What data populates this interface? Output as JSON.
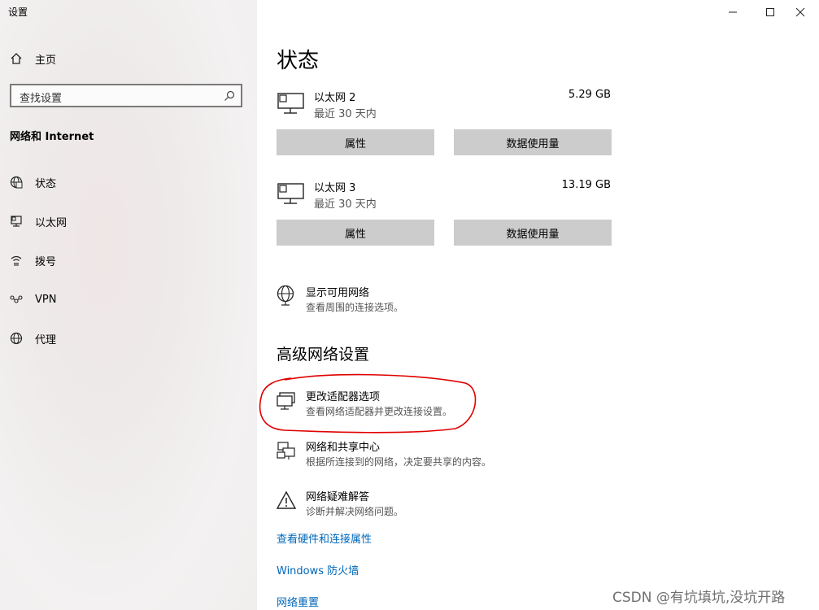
{
  "app": {
    "title": "设置"
  },
  "sidebar": {
    "home": "主页",
    "search_placeholder": "查找设置",
    "section": "网络和 Internet",
    "items": [
      {
        "label": "状态",
        "icon": "globe-status-icon"
      },
      {
        "label": "以太网",
        "icon": "ethernet-icon"
      },
      {
        "label": "拨号",
        "icon": "dialup-icon"
      },
      {
        "label": "VPN",
        "icon": "vpn-icon"
      },
      {
        "label": "代理",
        "icon": "globe-icon"
      }
    ]
  },
  "main": {
    "title": "状态",
    "networks": [
      {
        "name": "以太网 2",
        "sub": "最近 30 天内",
        "size": "5.29 GB",
        "btn_props": "属性",
        "btn_usage": "数据使用量"
      },
      {
        "name": "以太网 3",
        "sub": "最近 30 天内",
        "size": "13.19 GB",
        "btn_props": "属性",
        "btn_usage": "数据使用量"
      }
    ],
    "show_networks": {
      "title": "显示可用网络",
      "sub": "查看周围的连接选项。"
    },
    "advanced_title": "高级网络设置",
    "advanced": [
      {
        "title": "更改适配器选项",
        "sub": "查看网络适配器并更改连接设置。"
      },
      {
        "title": "网络和共享中心",
        "sub": "根据所连接到的网络，决定要共享的内容。"
      },
      {
        "title": "网络疑难解答",
        "sub": "诊断并解决网络问题。"
      }
    ],
    "links": [
      "查看硬件和连接属性",
      "Windows 防火墙",
      "网络重置"
    ]
  },
  "watermark": "CSDN @有坑填坑,没坑开路",
  "colors": {
    "link": "#0067b8",
    "button": "#cccccc",
    "annotation": "#e00000"
  }
}
